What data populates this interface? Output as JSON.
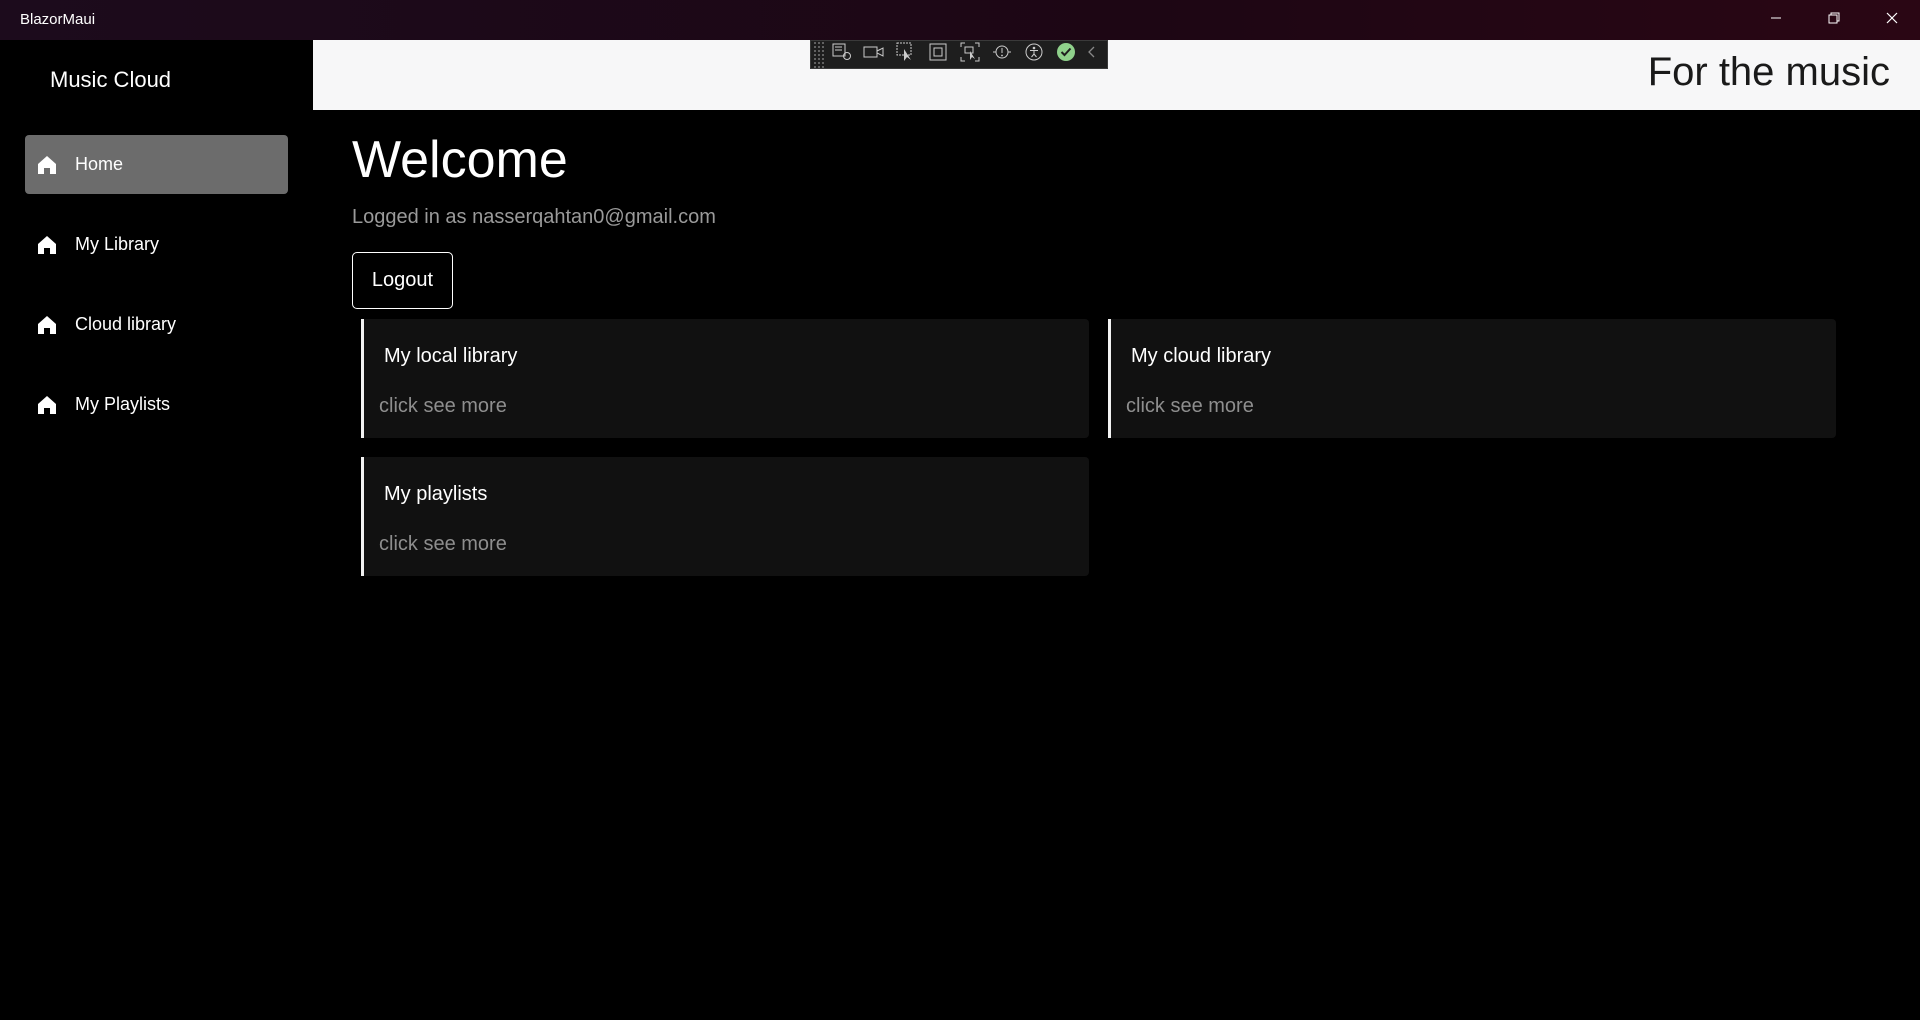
{
  "window": {
    "title": "BlazorMaui",
    "controls": [
      "minimize-icon",
      "restore-icon",
      "close-icon"
    ]
  },
  "sidebar": {
    "brand": "Music Cloud",
    "items": [
      {
        "label": "Home",
        "icon": "home-icon",
        "active": true
      },
      {
        "label": "My Library",
        "icon": "home-icon",
        "active": false
      },
      {
        "label": "Cloud library",
        "icon": "home-icon",
        "active": false
      },
      {
        "label": "My Playlists",
        "icon": "home-icon",
        "active": false
      }
    ]
  },
  "top_row": {
    "tagline": "For the music"
  },
  "debug_toolbar": {
    "buttons": [
      "live-visual-tree-icon",
      "record-icon",
      "select-element-icon",
      "display-layout-adorners-icon",
      "track-focus-icon",
      "binding-failures-icon",
      "accessibility-icon",
      "hot-reload-ok-icon",
      "collapse-chevron-icon"
    ]
  },
  "main": {
    "heading": "Welcome",
    "logged_in_text": "Logged in as nasserqahtan0@gmail.com",
    "logout_label": "Logout",
    "cards": [
      {
        "title": "My local library",
        "subtitle": "click see more"
      },
      {
        "title": "My cloud library",
        "subtitle": "click see more"
      },
      {
        "title": "My playlists",
        "subtitle": "click see more"
      }
    ]
  },
  "colors": {
    "background": "#000000",
    "active_nav": "#6c6c6c",
    "card_bg": "#111111",
    "top_row_bg": "#f7f7f8"
  }
}
